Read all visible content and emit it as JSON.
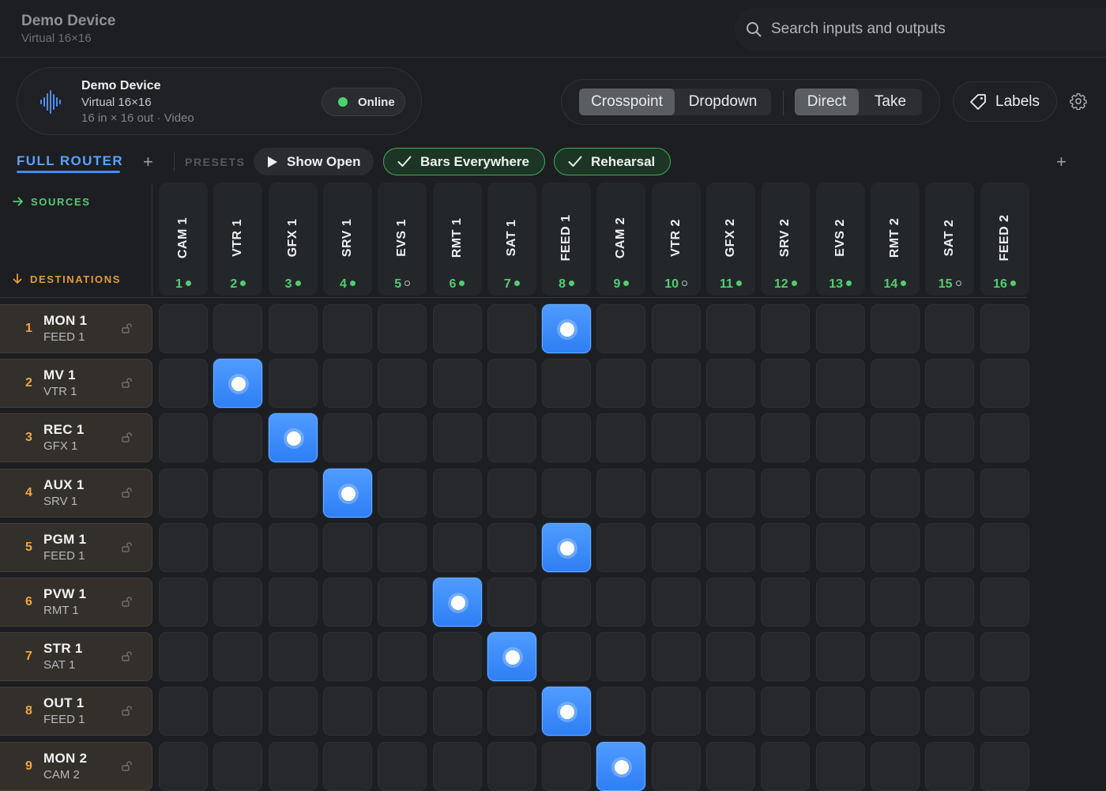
{
  "window": {
    "title": "Demo Device",
    "subtitle": "Virtual 16×16"
  },
  "search": {
    "placeholder": "Search inputs and outputs"
  },
  "device": {
    "name": "Demo Device",
    "type": "Virtual 16×16",
    "io": "16 in × 16 out · Video",
    "status": "Online",
    "status_color": "#4cd36c"
  },
  "view_modes": [
    "Crosspoint",
    "Dropdown"
  ],
  "active_view_mode": "Crosspoint",
  "take_modes": [
    "Direct",
    "Take"
  ],
  "active_take_mode": "Direct",
  "labels_button": "Labels",
  "tabs": {
    "full_router": "FULL ROUTER",
    "presets_label": "PRESETS"
  },
  "presets": [
    {
      "label": "Show Open",
      "icon": "play-icon",
      "active": false
    },
    {
      "label": "Bars Everywhere",
      "icon": "check-icon",
      "active": true
    },
    {
      "label": "Rehearsal",
      "icon": "check-icon",
      "active": true
    }
  ],
  "matrix": {
    "sources_label": "SOURCES",
    "destinations_label": "DESTINATIONS",
    "sources": [
      {
        "name": "CAM 1",
        "num": "1",
        "signal": true
      },
      {
        "name": "VTR 1",
        "num": "2",
        "signal": true
      },
      {
        "name": "GFX 1",
        "num": "3",
        "signal": true
      },
      {
        "name": "SRV 1",
        "num": "4",
        "signal": true
      },
      {
        "name": "EVS 1",
        "num": "5",
        "signal": false
      },
      {
        "name": "RMT 1",
        "num": "6",
        "signal": true
      },
      {
        "name": "SAT 1",
        "num": "7",
        "signal": true
      },
      {
        "name": "FEED 1",
        "num": "8",
        "signal": true
      },
      {
        "name": "CAM 2",
        "num": "9",
        "signal": true
      },
      {
        "name": "VTR 2",
        "num": "10",
        "signal": false
      },
      {
        "name": "GFX 2",
        "num": "11",
        "signal": true
      },
      {
        "name": "SRV 2",
        "num": "12",
        "signal": true
      },
      {
        "name": "EVS 2",
        "num": "13",
        "signal": true
      },
      {
        "name": "RMT 2",
        "num": "14",
        "signal": true
      },
      {
        "name": "SAT 2",
        "num": "15",
        "signal": false
      },
      {
        "name": "FEED 2",
        "num": "16",
        "signal": true
      }
    ],
    "destinations": [
      {
        "num": "1",
        "name": "MON 1",
        "source": "FEED 1",
        "route": 8
      },
      {
        "num": "2",
        "name": "MV 1",
        "source": "VTR 1",
        "route": 2
      },
      {
        "num": "3",
        "name": "REC 1",
        "source": "GFX 1",
        "route": 3
      },
      {
        "num": "4",
        "name": "AUX 1",
        "source": "SRV 1",
        "route": 4
      },
      {
        "num": "5",
        "name": "PGM 1",
        "source": "FEED 1",
        "route": 8
      },
      {
        "num": "6",
        "name": "PVW 1",
        "source": "RMT 1",
        "route": 6
      },
      {
        "num": "7",
        "name": "STR 1",
        "source": "SAT 1",
        "route": 7
      },
      {
        "num": "8",
        "name": "OUT 1",
        "source": "FEED 1",
        "route": 8
      },
      {
        "num": "9",
        "name": "MON 2",
        "source": "CAM 2",
        "route": 9
      }
    ]
  },
  "colors": {
    "accent": "#3d8ef8",
    "signal_ok": "#54cc71",
    "destination_accent": "#f0a640"
  }
}
